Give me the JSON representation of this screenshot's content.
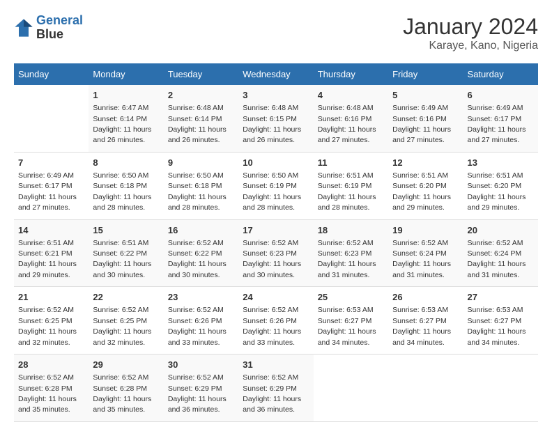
{
  "logo": {
    "line1": "General",
    "line2": "Blue"
  },
  "title": "January 2024",
  "subtitle": "Karaye, Kano, Nigeria",
  "days_of_week": [
    "Sunday",
    "Monday",
    "Tuesday",
    "Wednesday",
    "Thursday",
    "Friday",
    "Saturday"
  ],
  "weeks": [
    [
      {
        "day": "",
        "sunrise": "",
        "sunset": "",
        "daylight": ""
      },
      {
        "day": "1",
        "sunrise": "Sunrise: 6:47 AM",
        "sunset": "Sunset: 6:14 PM",
        "daylight": "Daylight: 11 hours and 26 minutes."
      },
      {
        "day": "2",
        "sunrise": "Sunrise: 6:48 AM",
        "sunset": "Sunset: 6:14 PM",
        "daylight": "Daylight: 11 hours and 26 minutes."
      },
      {
        "day": "3",
        "sunrise": "Sunrise: 6:48 AM",
        "sunset": "Sunset: 6:15 PM",
        "daylight": "Daylight: 11 hours and 26 minutes."
      },
      {
        "day": "4",
        "sunrise": "Sunrise: 6:48 AM",
        "sunset": "Sunset: 6:16 PM",
        "daylight": "Daylight: 11 hours and 27 minutes."
      },
      {
        "day": "5",
        "sunrise": "Sunrise: 6:49 AM",
        "sunset": "Sunset: 6:16 PM",
        "daylight": "Daylight: 11 hours and 27 minutes."
      },
      {
        "day": "6",
        "sunrise": "Sunrise: 6:49 AM",
        "sunset": "Sunset: 6:17 PM",
        "daylight": "Daylight: 11 hours and 27 minutes."
      }
    ],
    [
      {
        "day": "7",
        "sunrise": "Sunrise: 6:49 AM",
        "sunset": "Sunset: 6:17 PM",
        "daylight": "Daylight: 11 hours and 27 minutes."
      },
      {
        "day": "8",
        "sunrise": "Sunrise: 6:50 AM",
        "sunset": "Sunset: 6:18 PM",
        "daylight": "Daylight: 11 hours and 28 minutes."
      },
      {
        "day": "9",
        "sunrise": "Sunrise: 6:50 AM",
        "sunset": "Sunset: 6:18 PM",
        "daylight": "Daylight: 11 hours and 28 minutes."
      },
      {
        "day": "10",
        "sunrise": "Sunrise: 6:50 AM",
        "sunset": "Sunset: 6:19 PM",
        "daylight": "Daylight: 11 hours and 28 minutes."
      },
      {
        "day": "11",
        "sunrise": "Sunrise: 6:51 AM",
        "sunset": "Sunset: 6:19 PM",
        "daylight": "Daylight: 11 hours and 28 minutes."
      },
      {
        "day": "12",
        "sunrise": "Sunrise: 6:51 AM",
        "sunset": "Sunset: 6:20 PM",
        "daylight": "Daylight: 11 hours and 29 minutes."
      },
      {
        "day": "13",
        "sunrise": "Sunrise: 6:51 AM",
        "sunset": "Sunset: 6:20 PM",
        "daylight": "Daylight: 11 hours and 29 minutes."
      }
    ],
    [
      {
        "day": "14",
        "sunrise": "Sunrise: 6:51 AM",
        "sunset": "Sunset: 6:21 PM",
        "daylight": "Daylight: 11 hours and 29 minutes."
      },
      {
        "day": "15",
        "sunrise": "Sunrise: 6:51 AM",
        "sunset": "Sunset: 6:22 PM",
        "daylight": "Daylight: 11 hours and 30 minutes."
      },
      {
        "day": "16",
        "sunrise": "Sunrise: 6:52 AM",
        "sunset": "Sunset: 6:22 PM",
        "daylight": "Daylight: 11 hours and 30 minutes."
      },
      {
        "day": "17",
        "sunrise": "Sunrise: 6:52 AM",
        "sunset": "Sunset: 6:23 PM",
        "daylight": "Daylight: 11 hours and 30 minutes."
      },
      {
        "day": "18",
        "sunrise": "Sunrise: 6:52 AM",
        "sunset": "Sunset: 6:23 PM",
        "daylight": "Daylight: 11 hours and 31 minutes."
      },
      {
        "day": "19",
        "sunrise": "Sunrise: 6:52 AM",
        "sunset": "Sunset: 6:24 PM",
        "daylight": "Daylight: 11 hours and 31 minutes."
      },
      {
        "day": "20",
        "sunrise": "Sunrise: 6:52 AM",
        "sunset": "Sunset: 6:24 PM",
        "daylight": "Daylight: 11 hours and 31 minutes."
      }
    ],
    [
      {
        "day": "21",
        "sunrise": "Sunrise: 6:52 AM",
        "sunset": "Sunset: 6:25 PM",
        "daylight": "Daylight: 11 hours and 32 minutes."
      },
      {
        "day": "22",
        "sunrise": "Sunrise: 6:52 AM",
        "sunset": "Sunset: 6:25 PM",
        "daylight": "Daylight: 11 hours and 32 minutes."
      },
      {
        "day": "23",
        "sunrise": "Sunrise: 6:52 AM",
        "sunset": "Sunset: 6:26 PM",
        "daylight": "Daylight: 11 hours and 33 minutes."
      },
      {
        "day": "24",
        "sunrise": "Sunrise: 6:52 AM",
        "sunset": "Sunset: 6:26 PM",
        "daylight": "Daylight: 11 hours and 33 minutes."
      },
      {
        "day": "25",
        "sunrise": "Sunrise: 6:53 AM",
        "sunset": "Sunset: 6:27 PM",
        "daylight": "Daylight: 11 hours and 34 minutes."
      },
      {
        "day": "26",
        "sunrise": "Sunrise: 6:53 AM",
        "sunset": "Sunset: 6:27 PM",
        "daylight": "Daylight: 11 hours and 34 minutes."
      },
      {
        "day": "27",
        "sunrise": "Sunrise: 6:53 AM",
        "sunset": "Sunset: 6:27 PM",
        "daylight": "Daylight: 11 hours and 34 minutes."
      }
    ],
    [
      {
        "day": "28",
        "sunrise": "Sunrise: 6:52 AM",
        "sunset": "Sunset: 6:28 PM",
        "daylight": "Daylight: 11 hours and 35 minutes."
      },
      {
        "day": "29",
        "sunrise": "Sunrise: 6:52 AM",
        "sunset": "Sunset: 6:28 PM",
        "daylight": "Daylight: 11 hours and 35 minutes."
      },
      {
        "day": "30",
        "sunrise": "Sunrise: 6:52 AM",
        "sunset": "Sunset: 6:29 PM",
        "daylight": "Daylight: 11 hours and 36 minutes."
      },
      {
        "day": "31",
        "sunrise": "Sunrise: 6:52 AM",
        "sunset": "Sunset: 6:29 PM",
        "daylight": "Daylight: 11 hours and 36 minutes."
      },
      {
        "day": "",
        "sunrise": "",
        "sunset": "",
        "daylight": ""
      },
      {
        "day": "",
        "sunrise": "",
        "sunset": "",
        "daylight": ""
      },
      {
        "day": "",
        "sunrise": "",
        "sunset": "",
        "daylight": ""
      }
    ]
  ]
}
